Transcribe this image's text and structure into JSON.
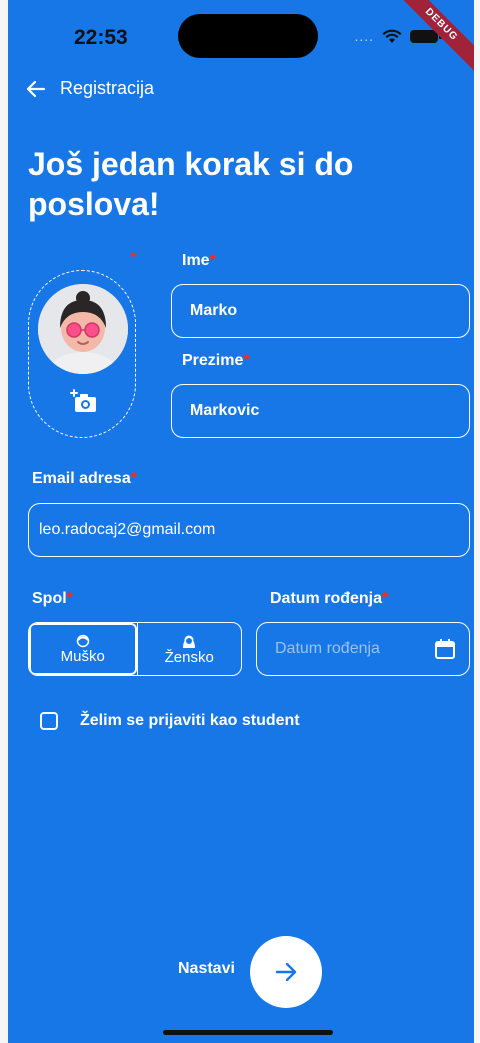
{
  "status_bar": {
    "time": "22:53",
    "signal": "....",
    "debug_label": "DEBUG"
  },
  "nav": {
    "back_icon": "arrow-left-icon",
    "title": "Registracija"
  },
  "heading": "Još jedan korak si do poslova!",
  "required_mark": "*",
  "avatar": {
    "icon": "add-photo-camera-icon"
  },
  "form": {
    "first_name": {
      "label": "Ime",
      "value": "Marko"
    },
    "last_name": {
      "label": "Prezime",
      "value": "Markovic"
    },
    "email": {
      "label": "Email adresa",
      "value": "leo.radocaj2@gmail.com"
    },
    "gender": {
      "label": "Spol",
      "options": [
        {
          "label": "Muško",
          "icon": "male-face-icon",
          "selected": true
        },
        {
          "label": "Žensko",
          "icon": "female-face-icon",
          "selected": false
        }
      ]
    },
    "birth_date": {
      "label": "Datum rođenja",
      "placeholder": "Datum rođenja",
      "icon": "calendar-icon"
    },
    "student_checkbox": {
      "label": "Želim se prijaviti kao student",
      "checked": false
    }
  },
  "footer": {
    "next_label": "Nastavi",
    "next_icon": "arrow-right-icon"
  },
  "colors": {
    "background": "#1877e6",
    "accent": "#ffffff",
    "required": "#e53030"
  }
}
